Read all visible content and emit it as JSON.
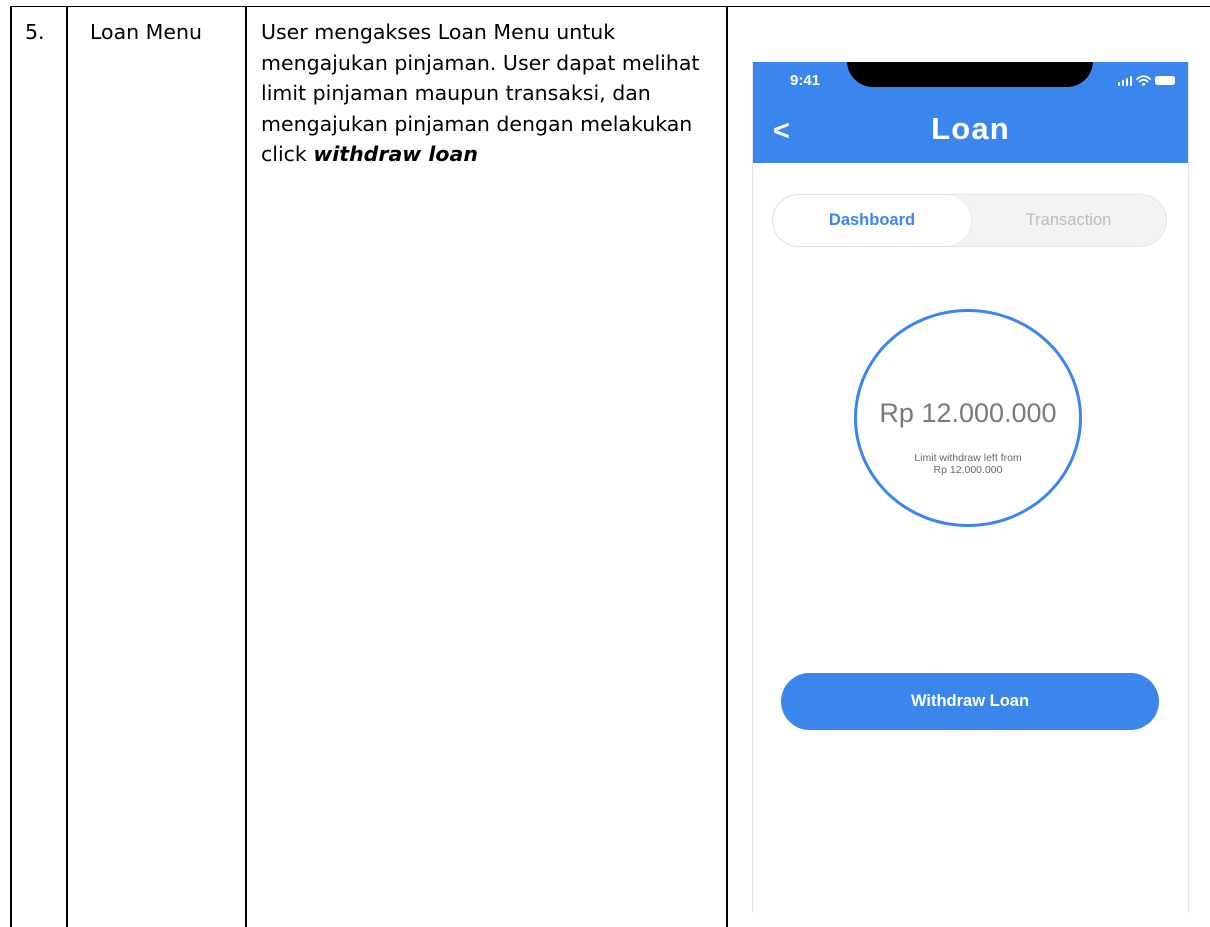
{
  "table_row": {
    "number": "5.",
    "name": "Loan Menu",
    "description_text": "User mengakses Loan Menu untuk mengajukan pinjaman. User dapat melihat limit pinjaman maupun transaksi, dan mengajukan pinjaman dengan melakukan click ",
    "description_emphasis": "withdraw loan"
  },
  "phone": {
    "status_time": "9:41",
    "back_label": "<",
    "title": "Loan",
    "tabs": [
      {
        "label": "Dashboard",
        "active": true
      },
      {
        "label": "Transaction",
        "active": false
      }
    ],
    "limit": {
      "amount": "Rp 12.000.000",
      "caption_line1": "Limit withdraw left from",
      "caption_line2": "Rp 12.000.000"
    },
    "withdraw_label": "Withdraw Loan",
    "icons": [
      "signal-icon",
      "wifi-icon",
      "battery-icon"
    ],
    "colors": {
      "accent": "#3b86ec",
      "inactive_tab_text": "#b9bbbf",
      "amount_text": "#7a7a7a"
    }
  }
}
